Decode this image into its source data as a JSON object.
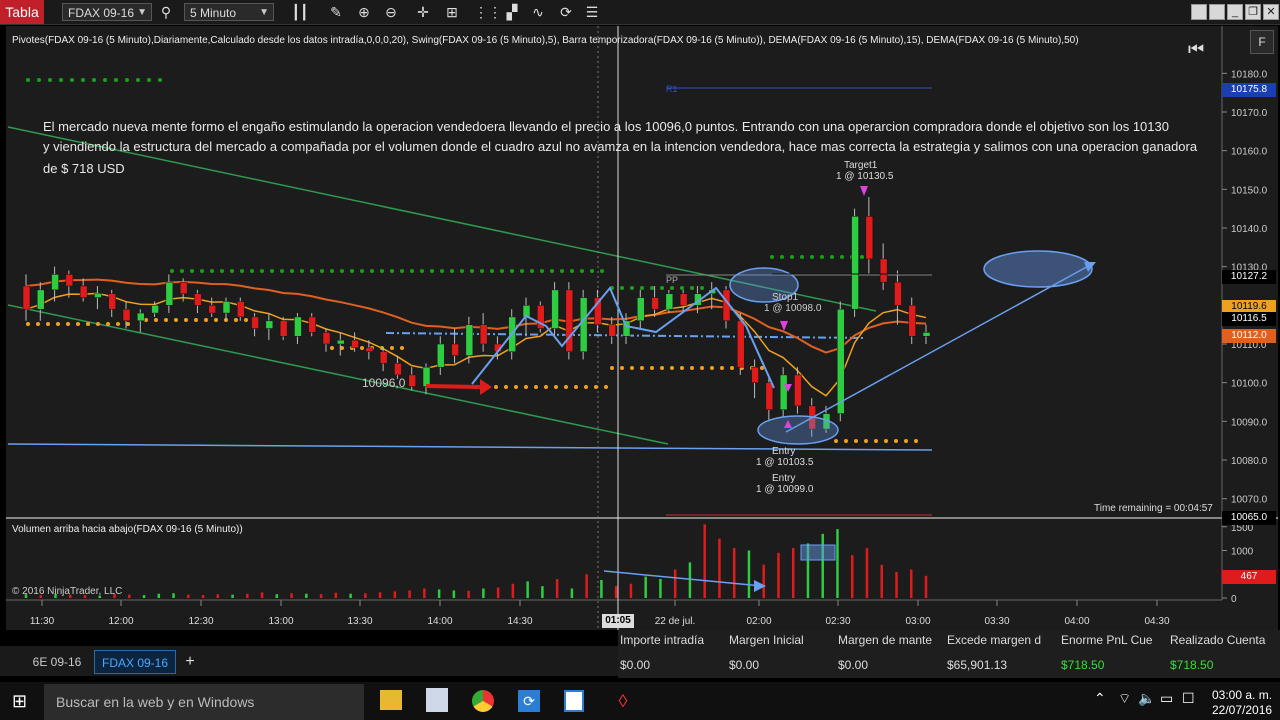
{
  "toolbar": {
    "app_label": "Tabla",
    "instrument": "FDAX 09-16",
    "interval": "5 Minuto"
  },
  "chart_header": "Pivotes(FDAX 09-16 (5 Minuto),Diariamente,Calculado desde los datos intradía,0,0,0,20), Swing(FDAX 09-16 (5 Minuto),5), Barra temporizadora(FDAX 09-16 (5 Minuto)), DEMA(FDAX 09-16 (5 Minuto),15), DEMA(FDAX 09-16 (5 Minuto),50)",
  "collapse_label": "F",
  "annotation": {
    "line1": "El mercado nueva mente formo el engaño estimulando la operacion vendedoera llevando el precio    a los 10096,0 puntos. Entrando con una operarcion compradora donde el objetivo son los 10130",
    "line2": "y viendiendo la estructura del mercado a compañada por el volumen donde el cuadro azul no avamza en la intencion vendedora, hace mas correcta la estrategia y salimos con una operacion ganadora",
    "line3": "de $ 718 USD"
  },
  "labels": {
    "price_10096": "10096,0",
    "target_name": "Target1",
    "target_fill": "1 @ 10130.5",
    "stop_name": "Stop1",
    "stop_fill": "1 @ 10098.0",
    "entry1_name": "Entry",
    "entry1_fill": "1 @ 10103.5",
    "entry2_name": "Entry",
    "entry2_fill": "1 @ 10099.0",
    "r1": "R1",
    "pp": "PP",
    "time_remaining": "Time remaining = 00:04:57",
    "volume_title": "Volumen arriba hacia abajo(FDAX 09-16 (5 Minuto))",
    "copyright": "© 2016 NinjaTrader, LLC",
    "cursor_time": "01:05"
  },
  "price_tags": [
    {
      "text": "10175.8",
      "y": 10175.8,
      "bg": "#1a3fb0",
      "fg": "#ffffff"
    },
    {
      "text": "10127.2",
      "y": 10127.2,
      "bg": "#000000",
      "fg": "#ffffff"
    },
    {
      "text": "10119.6",
      "y": 10119.6,
      "bg": "#f0a020",
      "fg": "#000000"
    },
    {
      "text": "10116.5",
      "y": 10116.5,
      "bg": "#000000",
      "fg": "#ffffff"
    },
    {
      "text": "10112.0",
      "y": 10112.0,
      "bg": "#e06020",
      "fg": "#ffffff"
    },
    {
      "text": "10065.0",
      "y": 10065.0,
      "bg": "#000000",
      "fg": "#ffffff"
    }
  ],
  "volume_tag": "467",
  "colors": {
    "up": "#2ecc40",
    "down": "#e01b1b",
    "dema15": "#f0a020",
    "dema50": "#e06020",
    "channel": "#2e9a4e",
    "trend": "#6aa0f0",
    "pivot_dot": "#f0a020",
    "swing_dot": "#1aa01a"
  },
  "chart_data": {
    "type": "candlestick",
    "ylim": [
      10065,
      10185
    ],
    "yticks": [
      "10180.0",
      "10170.0",
      "10160.0",
      "10150.0",
      "10140.0",
      "10130.0",
      "10120.0",
      "10110.0",
      "10100.0",
      "10090.0",
      "10080.0",
      "10070.0"
    ],
    "xticks": [
      "11:30",
      "12:00",
      "12:30",
      "13:00",
      "13:30",
      "14:00",
      "14:30",
      "22 de jul.",
      "02:00",
      "02:30",
      "03:00",
      "03:30",
      "04:00",
      "04:30"
    ],
    "vol_yticks": [
      "1500",
      "1000",
      "500",
      "0"
    ],
    "candles": [
      [
        10125,
        10128,
        10116,
        10119
      ],
      [
        10119,
        10126,
        10116,
        10124
      ],
      [
        10124,
        10130,
        10121,
        10128
      ],
      [
        10128,
        10129,
        10122,
        10125
      ],
      [
        10125,
        10127,
        10121,
        10122
      ],
      [
        10122,
        10125,
        10119,
        10123
      ],
      [
        10123,
        10124,
        10117,
        10119
      ],
      [
        10119,
        10121,
        10114,
        10116
      ],
      [
        10116,
        10119,
        10113,
        10118
      ],
      [
        10118,
        10121,
        10117,
        10120
      ],
      [
        10120,
        10128,
        10118,
        10126
      ],
      [
        10126,
        10127,
        10121,
        10123
      ],
      [
        10123,
        10124,
        10118,
        10120
      ],
      [
        10120,
        10122,
        10117,
        10118
      ],
      [
        10118,
        10122,
        10116,
        10121
      ],
      [
        10121,
        10122,
        10116,
        10117
      ],
      [
        10117,
        10118,
        10112,
        10114
      ],
      [
        10114,
        10118,
        10111,
        10116
      ],
      [
        10116,
        10117,
        10111,
        10112
      ],
      [
        10112,
        10118,
        10110,
        10117
      ],
      [
        10117,
        10118,
        10112,
        10113
      ],
      [
        10113,
        10114,
        10108,
        10110
      ],
      [
        10110,
        10113,
        10107,
        10111
      ],
      [
        10111,
        10113,
        10108,
        10109
      ],
      [
        10109,
        10111,
        10106,
        10108
      ],
      [
        10108,
        10109,
        10103,
        10105
      ],
      [
        10105,
        10107,
        10101,
        10102
      ],
      [
        10102,
        10104,
        10098,
        10099
      ],
      [
        10099,
        10105,
        10097,
        10104
      ],
      [
        10104,
        10112,
        10102,
        10110
      ],
      [
        10110,
        10114,
        10105,
        10107
      ],
      [
        10107,
        10117,
        10105,
        10115
      ],
      [
        10115,
        10118,
        10108,
        10110
      ],
      [
        10110,
        10112,
        10106,
        10108
      ],
      [
        10108,
        10119,
        10106,
        10117
      ],
      [
        10117,
        10122,
        10112,
        10120
      ],
      [
        10120,
        10121,
        10113,
        10114
      ],
      [
        10114,
        10126,
        10112,
        10124
      ],
      [
        10124,
        10126,
        10106,
        10108
      ],
      [
        10108,
        10124,
        10106,
        10122
      ],
      [
        10122,
        10124,
        10113,
        10115
      ],
      [
        10115,
        10117,
        10110,
        10112
      ],
      [
        10112,
        10118,
        10110,
        10116
      ],
      [
        10116,
        10124,
        10114,
        10122
      ],
      [
        10122,
        10125,
        10117,
        10119
      ],
      [
        10119,
        10124,
        10118,
        10123
      ],
      [
        10123,
        10124,
        10118,
        10120
      ],
      [
        10120,
        10125,
        10118,
        10123
      ],
      [
        10123,
        10126,
        10119,
        10124
      ],
      [
        10124,
        10125,
        10114,
        10116
      ],
      [
        10116,
        10118,
        10102,
        10104
      ],
      [
        10104,
        10106,
        10096,
        10100
      ],
      [
        10100,
        10102,
        10090,
        10093
      ],
      [
        10093,
        10104,
        10091,
        10102
      ],
      [
        10102,
        10104,
        10092,
        10094
      ],
      [
        10094,
        10096,
        10086,
        10088
      ],
      [
        10088,
        10094,
        10087,
        10092
      ],
      [
        10092,
        10121,
        10090,
        10119
      ],
      [
        10119,
        10145,
        10117,
        10143
      ],
      [
        10143,
        10148,
        10128,
        10132
      ],
      [
        10132,
        10136,
        10124,
        10126
      ],
      [
        10126,
        10129,
        10115,
        10120
      ],
      [
        10120,
        10122,
        10110,
        10112
      ],
      [
        10112,
        10115,
        10110,
        10113
      ]
    ],
    "volume": [
      80,
      60,
      90,
      70,
      60,
      50,
      80,
      70,
      60,
      90,
      100,
      70,
      60,
      80,
      70,
      90,
      120,
      80,
      100,
      90,
      80,
      110,
      90,
      100,
      120,
      140,
      160,
      200,
      180,
      160,
      150,
      200,
      220,
      300,
      350,
      250,
      400,
      200,
      500,
      380,
      250,
      300,
      450,
      400,
      600,
      750,
      1550,
      1250,
      1050,
      1000,
      700,
      950,
      1050,
      1150,
      1350,
      1450,
      900,
      1050,
      700,
      550,
      600,
      467
    ],
    "volume_up": [
      true,
      false,
      true,
      false,
      false,
      true,
      false,
      false,
      true,
      true,
      true,
      false,
      false,
      false,
      true,
      false,
      false,
      true,
      false,
      true,
      false,
      false,
      true,
      false,
      false,
      false,
      false,
      false,
      true,
      true,
      false,
      true,
      false,
      false,
      true,
      true,
      false,
      true,
      false,
      true,
      false,
      false,
      true,
      true,
      false,
      true,
      false,
      false,
      false,
      true,
      false,
      false,
      false,
      true,
      true,
      true,
      false,
      false,
      false,
      false,
      false,
      false
    ]
  },
  "tabs": [
    {
      "label": "6E 09-16"
    },
    {
      "label": "FDAX 09-16"
    }
  ],
  "tab_add": "+",
  "account": {
    "headers": [
      "Importe intradía",
      "Margen Inicial",
      "Margen de mante",
      "Excede margen d",
      "Enorme PnL Cue",
      "Realizado Cuenta"
    ],
    "values": [
      "$0.00",
      "$0.00",
      "$0.00",
      "$65,901.13",
      "$718.50",
      "$718.50"
    ]
  },
  "taskbar": {
    "search_placeholder": "Buscar en la web y en Windows",
    "time": "03:00 a. m.",
    "date": "22/07/2016"
  }
}
